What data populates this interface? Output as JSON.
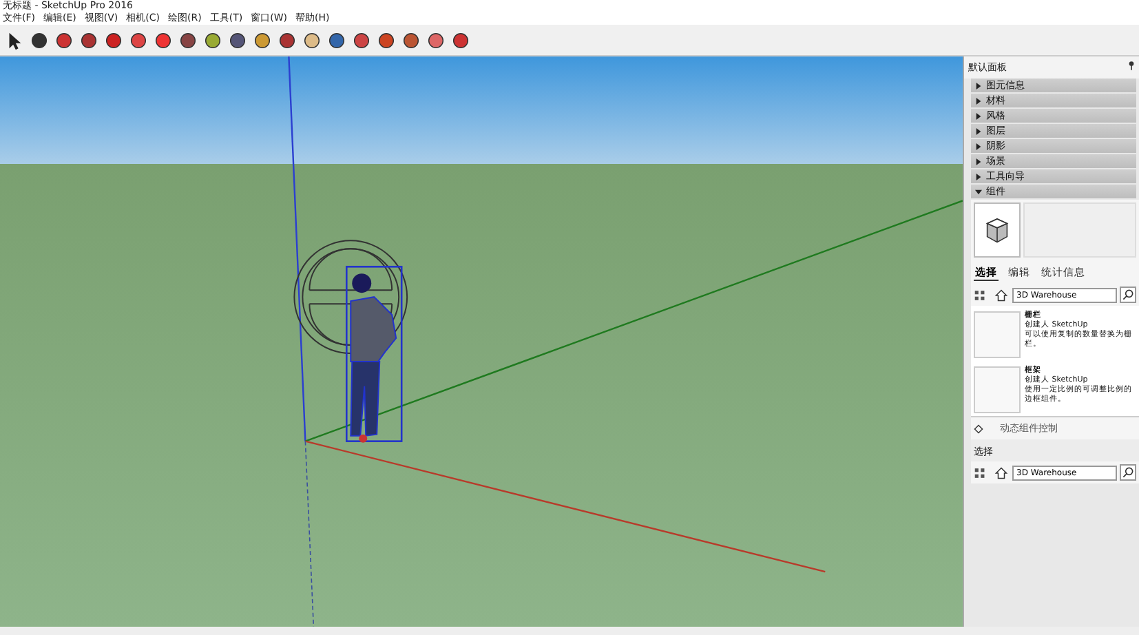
{
  "window": {
    "title": "无标题 - SketchUp Pro 2016"
  },
  "menu": [
    "文件(F)",
    "编辑(E)",
    "视图(V)",
    "相机(C)",
    "绘图(R)",
    "工具(T)",
    "窗口(W)",
    "帮助(H)"
  ],
  "panel": {
    "title": "默认面板",
    "sections": [
      {
        "label": "图元信息",
        "expanded": false
      },
      {
        "label": "材料",
        "expanded": false
      },
      {
        "label": "风格",
        "expanded": false
      },
      {
        "label": "图层",
        "expanded": false
      },
      {
        "label": "阴影",
        "expanded": false
      },
      {
        "label": "场景",
        "expanded": false
      },
      {
        "label": "工具向导",
        "expanded": false
      },
      {
        "label": "组件",
        "expanded": true
      }
    ],
    "tabs": [
      {
        "label": "选择",
        "selected": true
      },
      {
        "label": "编辑",
        "selected": false
      },
      {
        "label": "统计信息",
        "selected": false
      }
    ],
    "search": {
      "value": "3D Warehouse"
    },
    "items": [
      {
        "name": "栅栏",
        "author": "创建人 SketchUp",
        "description": "可以使用复制的数量替换为栅栏。"
      },
      {
        "name": "框架",
        "author": "创建人 SketchUp",
        "description": "使用一定比例的可调整比例的边框组件。"
      }
    ],
    "footer": "动态组件控制",
    "second": {
      "title": "选择",
      "search": "3D Warehouse"
    }
  }
}
